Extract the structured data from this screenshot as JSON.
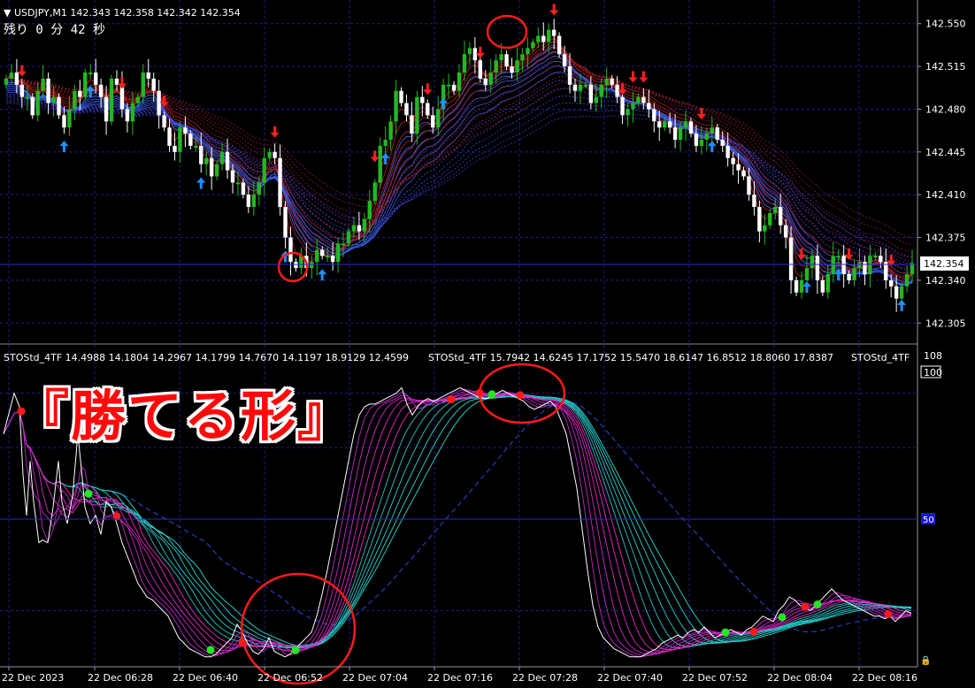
{
  "price_panel": {
    "header": "USDJPY,M1  142.343 142.358 142.342 142.354",
    "timer": "残り  0 分 42 秒",
    "current_price": "142.354",
    "price_levels": [
      "142.550",
      "142.515",
      "142.480",
      "142.445",
      "142.410",
      "142.375",
      "142.340",
      "142.305"
    ]
  },
  "oscillator_panel": {
    "header_segments": [
      "STOStd_4TF 14.4988 14.1804 14.2967 14.1799 14.7670 14.1197 18.9129 12.4599",
      "STOStd_4TF 15.7942 14.6245 17.1752 15.5470 18.6147 16.8512 18.8060 17.8387",
      "STOStd_4TF"
    ],
    "scale_top": "108",
    "scale_100": "100",
    "mid_level": "50",
    "overlay_label": "『勝てる形』"
  },
  "time_axis": [
    "22 Dec 2023",
    "22 Dec 06:28",
    "22 Dec 06:40",
    "22 Dec 06:52",
    "22 Dec 07:04",
    "22 Dec 07:16",
    "22 Dec 07:28",
    "22 Dec 07:40",
    "22 Dec 07:52",
    "22 Dec 08:04",
    "22 Dec 08:16"
  ],
  "colors": {
    "background": "#000000",
    "grid": "#1e1e8c",
    "bull_candle": "#22b822",
    "bear_candle": "#ffffff",
    "up_arrow": "#1e90ff",
    "down_arrow": "#ff2020",
    "annotation_circle": "#ff1a1a"
  },
  "chart_data": [
    {
      "type": "candlestick",
      "title": "USDJPY,M1",
      "ylim": [
        142.29,
        142.565
      ],
      "ohlc": [
        142.343,
        142.358,
        142.342,
        142.354
      ],
      "close": [
        142.505,
        142.51,
        142.5,
        142.49,
        142.49,
        142.475,
        142.495,
        142.505,
        142.485,
        142.49,
        142.475,
        142.465,
        142.48,
        142.495,
        142.49,
        142.51,
        142.51,
        142.5,
        142.49,
        142.47,
        142.505,
        142.5,
        142.48,
        142.47,
        142.485,
        142.49,
        142.51,
        142.505,
        142.495,
        142.475,
        142.465,
        142.45,
        142.445,
        142.465,
        142.46,
        142.45,
        142.45,
        142.435,
        142.44,
        142.425,
        142.435,
        142.445,
        142.43,
        142.42,
        142.42,
        142.41,
        142.4,
        142.41,
        142.42,
        142.44,
        142.445,
        142.44,
        142.4,
        142.375,
        142.355,
        142.35,
        142.36,
        142.35,
        142.355,
        142.365,
        142.36,
        142.36,
        142.355,
        142.37,
        142.37,
        142.38,
        142.385,
        142.38,
        142.39,
        142.405,
        142.42,
        142.45,
        142.455,
        142.47,
        142.495,
        142.485,
        142.475,
        142.46,
        142.49,
        142.485,
        142.475,
        142.465,
        142.48,
        142.5,
        142.5,
        142.495,
        142.51,
        142.525,
        142.53,
        142.52,
        142.505,
        142.5,
        142.51,
        142.52,
        142.525,
        142.515,
        142.51,
        142.52,
        142.525,
        142.53,
        142.535,
        142.54,
        142.535,
        142.545,
        142.54,
        142.525,
        142.515,
        142.5,
        142.495,
        142.5,
        142.5,
        142.485,
        142.49,
        142.5,
        142.505,
        142.5,
        142.49,
        142.475,
        142.48,
        142.485,
        142.49,
        142.485,
        142.48,
        142.47,
        142.465,
        142.47,
        142.465,
        142.455,
        142.465,
        142.47,
        142.46,
        142.45,
        142.455,
        142.46,
        142.465,
        142.455,
        142.45,
        142.44,
        142.435,
        142.43,
        142.425,
        142.41,
        142.4,
        142.38,
        142.385,
        142.395,
        142.4,
        142.385,
        142.375,
        142.34,
        142.33,
        142.34,
        142.35,
        142.36,
        142.34,
        142.33,
        142.345,
        142.36,
        142.36,
        142.345,
        142.34,
        142.35,
        142.355,
        142.345,
        142.36,
        142.36,
        142.355,
        142.34,
        142.335,
        142.325,
        142.335,
        142.345,
        142.354
      ]
    },
    {
      "type": "line",
      "title": "STOStd_4TF",
      "ylim": [
        0,
        108
      ],
      "midline": 50,
      "x": [
        0,
        12,
        18,
        22,
        26,
        30,
        34,
        40,
        44,
        50,
        56,
        62,
        66,
        72,
        78,
        84,
        88,
        92,
        98,
        104,
        110,
        116,
        122,
        128,
        134,
        140,
        146,
        152,
        156,
        162,
        168,
        174,
        180,
        186,
        192,
        198,
        204,
        210,
        216,
        222,
        228,
        234,
        240,
        246,
        252,
        258,
        264,
        270,
        276,
        282,
        288,
        294,
        300,
        306,
        312,
        318,
        324,
        330,
        336,
        342,
        348,
        354,
        360,
        366,
        372,
        378,
        384,
        390,
        396,
        402,
        408,
        414,
        420,
        426,
        432,
        438,
        444,
        450,
        456,
        462,
        468,
        474,
        480,
        486,
        492,
        498,
        504,
        510,
        516,
        522,
        528,
        534,
        540,
        546,
        552,
        558,
        564,
        570,
        576,
        582,
        588,
        594,
        600,
        606,
        612,
        618,
        624,
        630,
        636,
        642,
        648,
        654,
        660,
        666,
        672,
        678,
        684,
        690,
        696,
        702,
        708,
        714,
        720,
        726,
        732,
        738,
        744,
        750,
        756,
        762,
        768,
        774,
        780,
        786,
        792,
        798,
        804,
        810,
        816,
        822,
        828,
        834,
        840,
        846,
        852,
        858,
        864,
        870,
        876,
        882,
        888,
        894,
        900,
        906,
        912,
        918,
        924,
        930,
        936,
        942,
        948,
        954,
        960,
        966,
        972,
        978,
        984,
        990,
        996,
        1002,
        1008,
        1014,
        1020,
        1026
      ],
      "series": [
        {
          "values": [
            85,
            100,
            95,
            70,
            55,
            75,
            60,
            45,
            46,
            45,
            58,
            75,
            60,
            52,
            62,
            85,
            72,
            58,
            52,
            55,
            48,
            60,
            58,
            52,
            45,
            40,
            35,
            30,
            28,
            25,
            24,
            22,
            20,
            18,
            14,
            10,
            8,
            6,
            5,
            4,
            3,
            3,
            4,
            6,
            8,
            10,
            15,
            12,
            8,
            5,
            4,
            6,
            10,
            5,
            4,
            3,
            4,
            6,
            8,
            10,
            12,
            18,
            26,
            35,
            45,
            55,
            65,
            75,
            85,
            92,
            95,
            96,
            96,
            97,
            98,
            99,
            100,
            102,
            96,
            92,
            95,
            97,
            98,
            97,
            98,
            99,
            100,
            101,
            102,
            101,
            100,
            99,
            98,
            98,
            99,
            100,
            101,
            100,
            99,
            98,
            97,
            95,
            94,
            95,
            96,
            97,
            95,
            90,
            85,
            75,
            65,
            50,
            35,
            22,
            14,
            10,
            8,
            6,
            5,
            4,
            3,
            3,
            3,
            4,
            5,
            6,
            8,
            9,
            10,
            11,
            10,
            12,
            13,
            12,
            14,
            12,
            10,
            11,
            12,
            13,
            12,
            11,
            13,
            14,
            16,
            18,
            17,
            16,
            20,
            22,
            25,
            24,
            22,
            21,
            20,
            22,
            24,
            26,
            28,
            26,
            24,
            23,
            22,
            21,
            20,
            19,
            18,
            18,
            17,
            18,
            16,
            18,
            20,
            19,
            20,
            23
          ]
        }
      ]
    }
  ]
}
